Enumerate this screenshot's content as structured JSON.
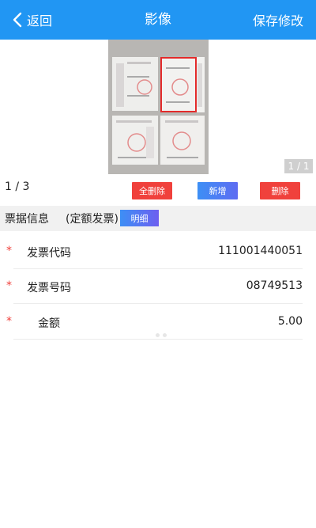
{
  "header": {
    "back_label": "返回",
    "title": "影像",
    "save_label": "保存修改"
  },
  "preview": {
    "page_indicator": "1 / 1"
  },
  "actions": {
    "counter": "1 / 3",
    "delete_all": "全删除",
    "add": "新增",
    "delete": "删除"
  },
  "section": {
    "title": "票据信息",
    "type": "(定额发票)",
    "detail_button": "明细"
  },
  "fields": [
    {
      "required": "*",
      "label": "发票代码",
      "value": "111001440051"
    },
    {
      "required": "*",
      "label": "发票号码",
      "value": "08749513"
    },
    {
      "required": "*",
      "label": "金额",
      "value": "5.00"
    }
  ],
  "colors": {
    "navbar": "#2196F3",
    "danger": "#f0413c",
    "primary_gradient": [
      "#3d8ff5",
      "#5e6cf2"
    ]
  },
  "icons": {
    "back": "chevron-left-icon"
  }
}
